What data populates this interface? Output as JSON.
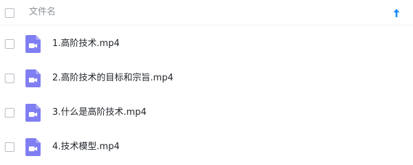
{
  "header": {
    "column_title": "文件名",
    "sort_icon": "arrow-up-icon",
    "accent_color": "#1a8cff"
  },
  "files": [
    {
      "name": "1.高阶技术.mp4",
      "icon": "video-file-icon"
    },
    {
      "name": "2.高阶技术的目标和宗旨.mp4",
      "icon": "video-file-icon"
    },
    {
      "name": "3.什么是高阶技术.mp4",
      "icon": "video-file-icon"
    },
    {
      "name": "4.技术模型.mp4",
      "icon": "video-file-icon"
    }
  ],
  "colors": {
    "video_icon": "#7f7ef2"
  }
}
